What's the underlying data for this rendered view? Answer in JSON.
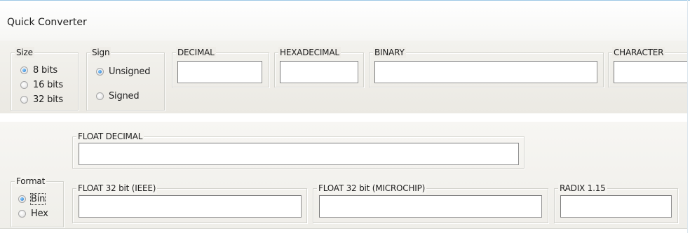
{
  "window": {
    "title": "Quick Converter"
  },
  "size_group": {
    "label": "Size",
    "options": [
      {
        "label": "8 bits",
        "selected": true
      },
      {
        "label": "16 bits",
        "selected": false
      },
      {
        "label": "32 bits",
        "selected": false
      }
    ]
  },
  "sign_group": {
    "label": "Sign",
    "options": [
      {
        "label": "Unsigned",
        "selected": true
      },
      {
        "label": "Signed",
        "selected": false
      }
    ]
  },
  "fields": {
    "decimal": {
      "label": "DECIMAL",
      "value": ""
    },
    "hexadecimal": {
      "label": "HEXADECIMAL",
      "value": ""
    },
    "binary": {
      "label": "BINARY",
      "value": ""
    },
    "character": {
      "label": "CHARACTER",
      "value": ""
    },
    "float_decimal": {
      "label": "FLOAT DECIMAL",
      "value": ""
    },
    "float32_ieee": {
      "label": "FLOAT 32 bit (IEEE)",
      "value": ""
    },
    "float32_microchip": {
      "label": "FLOAT 32 bit (MICROCHIP)",
      "value": ""
    },
    "radix_115": {
      "label": "RADIX 1.15",
      "value": ""
    }
  },
  "format_group": {
    "label": "Format",
    "options": [
      {
        "label": "Bin",
        "selected": true
      },
      {
        "label": "Hex",
        "selected": false
      }
    ]
  },
  "colors": {
    "radio_selected": "#1a6fc8",
    "groupbox_border": "#d2d2cc",
    "panel_bg": "#efede8"
  }
}
